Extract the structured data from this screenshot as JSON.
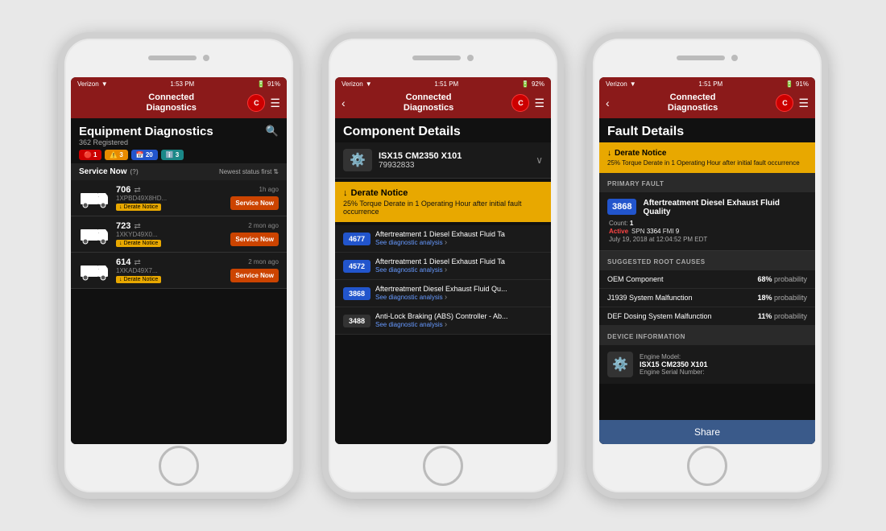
{
  "app": {
    "name": "Connected Diagnostics",
    "status_carrier": "Verizon",
    "battery_pct": "91%",
    "cummins_logo": "C"
  },
  "phone1": {
    "time": "1:53 PM",
    "battery": "91%",
    "header_title": "Connected\nDiagnostics",
    "screen": {
      "title": "Equipment Diagnostics",
      "subtitle": "362 Registered",
      "tabs": [
        {
          "id": "red",
          "count": "1",
          "color": "red"
        },
        {
          "id": "yellow",
          "count": "3",
          "color": "yellow"
        },
        {
          "id": "calendar",
          "count": "20",
          "color": "blue"
        },
        {
          "id": "info",
          "count": "3",
          "color": "teal"
        }
      ],
      "service_now_label": "Service Now",
      "sort_label": "Newest status first",
      "vehicles": [
        {
          "id": "706",
          "vin": "1XPBD49X8HD...",
          "time": "1h ago",
          "action": "Service Now",
          "notice": "Derate Notice"
        },
        {
          "id": "723",
          "vin": "1XKYD49X0...",
          "time": "2 mon ago",
          "action": "Service Now",
          "notice": "Derate Notice"
        },
        {
          "id": "614",
          "vin": "1XKAD49X7...",
          "time": "2 mon ago",
          "action": "Service Now",
          "notice": "Derate Notice"
        }
      ]
    }
  },
  "phone2": {
    "time": "1:51 PM",
    "battery": "92%",
    "header_title": "Connected\nDiagnostics",
    "screen": {
      "title": "Component Details",
      "vehicle_name": "ISX15 CM2350 X101",
      "vehicle_vin": "79932833",
      "derate_notice": {
        "title": "Derate Notice",
        "description": "25% Torque Derate in 1 Operating Hour after initial fault occurrence"
      },
      "faults": [
        {
          "code": "4677",
          "desc": "Aftertreatment 1 Diesel Exhaust Fluid Ta",
          "link": "See diagnostic analysis"
        },
        {
          "code": "4572",
          "desc": "Aftertreatment 1 Diesel Exhaust Fluid Ta",
          "link": "See diagnostic analysis"
        },
        {
          "code": "3868",
          "desc": "Aftertreatment Diesel Exhaust Fluid Qu...",
          "link": "See diagnostic analysis"
        },
        {
          "code": "3488",
          "desc": "Anti-Lock Braking (ABS) Controller - Ab...",
          "link": "See diagnostic analysis"
        }
      ]
    }
  },
  "phone3": {
    "time": "1:51 PM",
    "battery": "91%",
    "header_title": "Connected\nDiagnostics",
    "screen": {
      "title": "Fault Details",
      "derate_notice": {
        "title": "Derate Notice",
        "description": "25% Torque Derate in 1 Operating Hour after initial fault occurrence"
      },
      "primary_fault_section": "PRIMARY FAULT",
      "primary_fault": {
        "code": "3868",
        "title": "Aftertreatment Diesel Exhaust Fluid Quality",
        "count_label": "Count:",
        "count": "1",
        "spn_label": "SPN",
        "spn": "3364",
        "fmi_label": "FMI",
        "fmi": "9",
        "status": "Active",
        "date": "July 19, 2018 at 12:04:52 PM EDT"
      },
      "root_causes_section": "SUGGESTED ROOT CAUSES",
      "root_causes": [
        {
          "name": "OEM Component",
          "pct": "68%",
          "label": "probability"
        },
        {
          "name": "J1939 System Malfunction",
          "pct": "18%",
          "label": "probability"
        },
        {
          "name": "DEF Dosing System Malfunction",
          "pct": "11%",
          "label": "probability"
        }
      ],
      "device_info_section": "DEVICE INFORMATION",
      "device_info": {
        "label": "Engine Model:",
        "value": "ISX15 CM2350 X101",
        "serial_label": "Engine Serial Number:"
      },
      "share_button": "Share"
    }
  }
}
